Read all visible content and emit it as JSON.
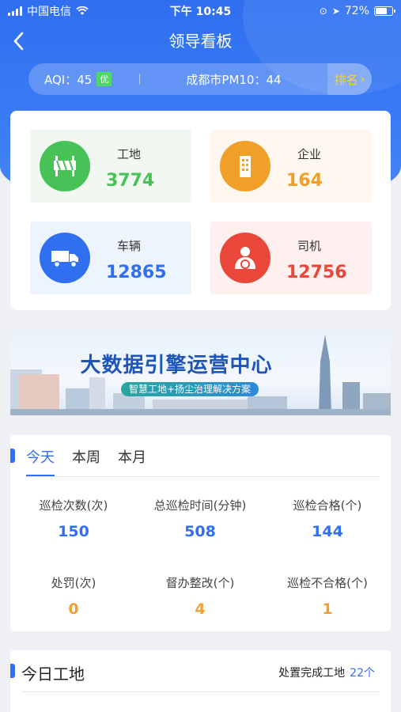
{
  "status_bar": {
    "carrier": "中国电信",
    "time": "下午 10:45",
    "battery": "72%",
    "battery_level": 0.72
  },
  "nav": {
    "back_icon": "‹",
    "title": "领导看板"
  },
  "aqi": {
    "label": "AQI：45",
    "badge": "优",
    "pm": "成都市PM10：44",
    "rank_label": "排名",
    "rank_icon": "›"
  },
  "stats": [
    {
      "label": "工地",
      "value": "3774",
      "icon": "construction-barrier-icon",
      "color": "#48c257",
      "bg": "#f1f8f1"
    },
    {
      "label": "企业",
      "value": "164",
      "icon": "building-icon",
      "color": "#f0a028",
      "bg": "#fdf7ef"
    },
    {
      "label": "车辆",
      "value": "12865",
      "icon": "truck-icon",
      "color": "#2f6ff0",
      "bg": "#eef4fd"
    },
    {
      "label": "司机",
      "value": "12756",
      "icon": "driver-icon",
      "color": "#e8473a",
      "bg": "#fdf0ef"
    }
  ],
  "banner": {
    "title": "大数据引擎运营中心",
    "subtitle": "智慧工地+扬尘治理解决方案"
  },
  "patrol": {
    "tabs": [
      "今天",
      "本周",
      "本月"
    ],
    "active_tab": 0,
    "metrics": [
      {
        "label": "巡检次数(次)",
        "value": "150",
        "color": "blue"
      },
      {
        "label": "总巡检时间(分钟)",
        "value": "508",
        "color": "blue"
      },
      {
        "label": "巡检合格(个)",
        "value": "144",
        "color": "blue"
      },
      {
        "label": "处罚(次)",
        "value": "0",
        "color": "orange"
      },
      {
        "label": "督办整改(个)",
        "value": "4",
        "color": "orange"
      },
      {
        "label": "巡检不合格(个)",
        "value": "1",
        "color": "orange"
      }
    ]
  },
  "today_sites": {
    "title": "今日工地",
    "completed_label": "处置完成工地",
    "completed_count": "22个"
  }
}
